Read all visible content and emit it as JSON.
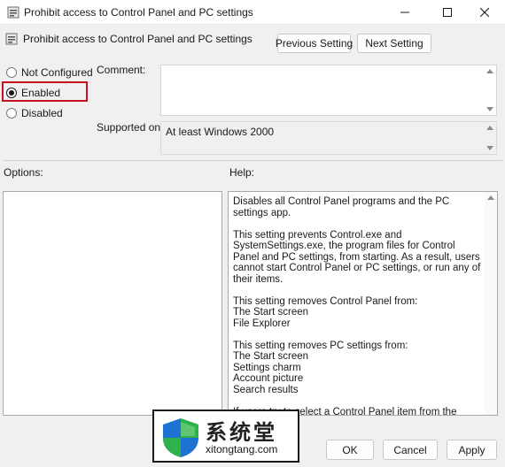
{
  "window": {
    "title": "Prohibit access to Control Panel and PC settings",
    "icon": "policy-setting-icon"
  },
  "header": {
    "setting_name": "Prohibit access to Control Panel and PC settings",
    "prev_label": "Previous Setting",
    "next_label": "Next Setting"
  },
  "state": {
    "options": [
      {
        "label": "Not Configured",
        "checked": false
      },
      {
        "label": "Enabled",
        "checked": true
      },
      {
        "label": "Disabled",
        "checked": false
      }
    ],
    "highlight_color": "#c8101f"
  },
  "comment": {
    "label": "Comment:",
    "value": ""
  },
  "supported": {
    "label": "Supported on:",
    "value": "At least Windows 2000"
  },
  "options_pane": {
    "label": "Options:"
  },
  "help_pane": {
    "label": "Help:",
    "paragraphs": [
      "Disables all Control Panel programs and the PC settings app.",
      "This setting prevents Control.exe and SystemSettings.exe, the program files for Control Panel and PC settings, from starting. As a result, users cannot start Control Panel or PC settings, or run any of their items.",
      "This setting removes Control Panel from:\nThe Start screen\nFile Explorer",
      "This setting removes PC settings from:\nThe Start screen\nSettings charm\nAccount picture\nSearch results",
      "If users try to select a Control Panel item from the Properties item on a context menu, a message appears explaining that a setting prevents the action."
    ]
  },
  "footer": {
    "ok_label": "OK",
    "cancel_label": "Cancel",
    "apply_label": "Apply"
  },
  "watermark": {
    "brand": "系统堂",
    "url": "xitongtang.com",
    "colors": {
      "shield_blue": "#1e73d2",
      "shield_green": "#2fb24a"
    }
  }
}
